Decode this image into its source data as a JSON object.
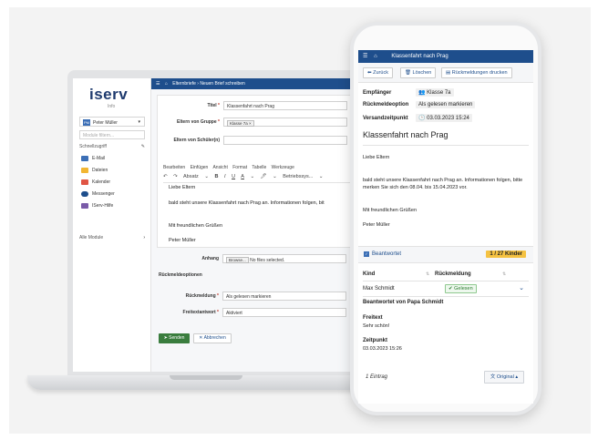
{
  "laptop": {
    "logo": "iserv",
    "logo_sub": "Info",
    "user": {
      "initials": "PM",
      "name": "Peter Müller"
    },
    "module_search_placeholder": "Module filtern...",
    "quick_access": "Schnellzugriff",
    "nav": [
      {
        "label": "E-Mail",
        "icon": "mail-icon",
        "color": "#3c6fb6"
      },
      {
        "label": "Dateien",
        "icon": "folder-icon",
        "color": "#f2b632"
      },
      {
        "label": "Kalender",
        "icon": "calendar-icon",
        "color": "#e05545"
      },
      {
        "label": "Messenger",
        "icon": "chat-icon",
        "color": "#1e4e8c"
      },
      {
        "label": "IServ-Hilfe",
        "icon": "help-icon",
        "color": "#7a5ba8"
      }
    ],
    "all_modules": "Alle Module",
    "breadcrumb": [
      "Elternbriefe",
      "Neuen Brief schreiben"
    ],
    "form": {
      "title_label": "Titel",
      "title_value": "Klassenfahrt nach Prag",
      "parents_group_label": "Eltern von Gruppe",
      "parents_group_tag": "Klasse 7a ×",
      "parents_students_label": "Eltern von Schüler(n)",
      "menu": [
        "Bearbeiten",
        "Einfügen",
        "Ansicht",
        "Format",
        "Tabelle",
        "Werkzeuge"
      ],
      "toolbar": [
        "↶",
        "↷",
        "Absatz",
        "⌄",
        "B",
        "I",
        "U",
        "A",
        "⌄",
        "🖊",
        "⌄",
        "Betriebssys...",
        "⌄"
      ],
      "editor_lines": [
        "Liebe Eltern",
        "bald steht unsere Klassenfahrt nach Prag an. Informationen folgen, bit",
        "Mit freundlichen Grüßen",
        "Peter Müller"
      ],
      "attachment_label": "Anhang",
      "browse_button": "Browse...",
      "no_files": "No files selected.",
      "feedback_options_title": "Rückmeldeoptionen",
      "feedback_label": "Rückmeldung",
      "feedback_value": "Als gelesen markieren",
      "freetext_label": "Freitextantwort",
      "freetext_value": "Aktiviert",
      "send_button": "Senden",
      "cancel_button": "Abbrechen"
    }
  },
  "phone": {
    "header_title": "Klassenfahrt nach Prag",
    "buttons": {
      "back": "Zurück",
      "delete": "Löschen",
      "print": "Rückmeldungen drucken"
    },
    "recipient_label": "Empfänger",
    "recipient_value": "Klasse 7a",
    "feedback_option_label": "Rückmeldeoption",
    "feedback_option_value": "Als gelesen markieren",
    "sent_time_label": "Versandzeitpunkt",
    "sent_time_value": "03.03.2023 15:24",
    "subject": "Klassenfahrt nach Prag",
    "greeting": "Liebe Eltern",
    "body": "bald steht unsere Klassenfahrt nach Prag an. Informationen folgen, bitte merken Sie sich den 08.04. bis 15.04.2023 vor.",
    "closing": "Mit freundlichen Grüßen",
    "signature": "Peter Müller",
    "answered_label": "Beantwortet",
    "answered_badge": "1 / 27 Kinder",
    "table": {
      "col_child": "Kind",
      "col_feedback": "Rückmeldung",
      "row": {
        "child": "Max Schmidt",
        "status": "Gelesen"
      }
    },
    "answered_by": "Beantwortet von Papa Schmidt",
    "freetext_label": "Freitext",
    "freetext_value": "Sehr schön!",
    "time_label": "Zeitpunkt",
    "time_value": "03.03.2023 15:26",
    "entry_count": "1 Eintrag",
    "original_button": "Original"
  }
}
